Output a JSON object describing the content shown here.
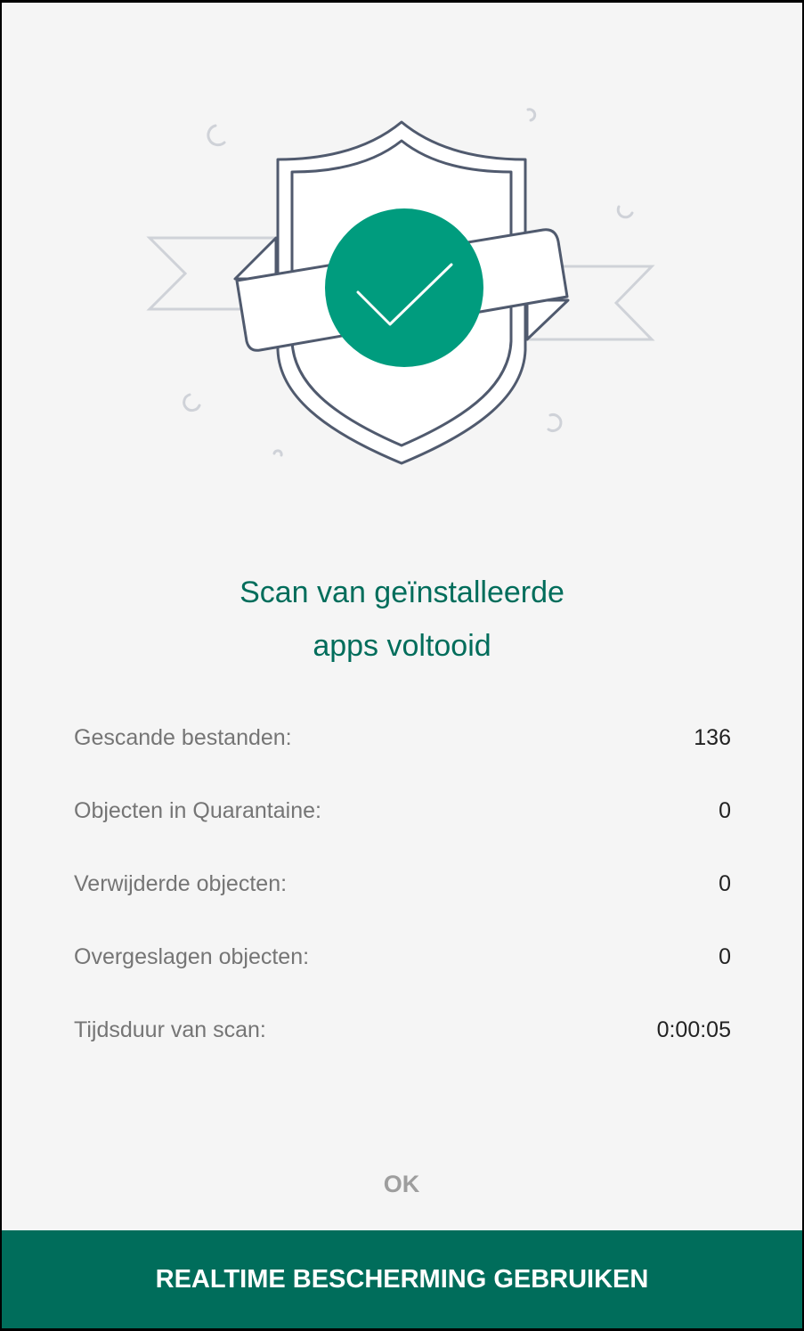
{
  "illustration": {
    "icon": "shield-checkmark-icon",
    "accent_color": "#009c7e"
  },
  "result": {
    "title_line1": "Scan van geïnstalleerde",
    "title_line2": "apps voltooid"
  },
  "stats": [
    {
      "label": "Gescande bestanden:",
      "value": "136"
    },
    {
      "label": "Objecten in Quarantaine:",
      "value": "0"
    },
    {
      "label": "Verwijderde objecten:",
      "value": "0"
    },
    {
      "label": "Overgeslagen objecten:",
      "value": "0"
    },
    {
      "label": "Tijdsduur van scan:",
      "value": "0:00:05"
    }
  ],
  "actions": {
    "ok_label": "OK",
    "primary_label": "REALTIME BESCHERMING GEBRUIKEN",
    "primary_color": "#006d5b"
  }
}
